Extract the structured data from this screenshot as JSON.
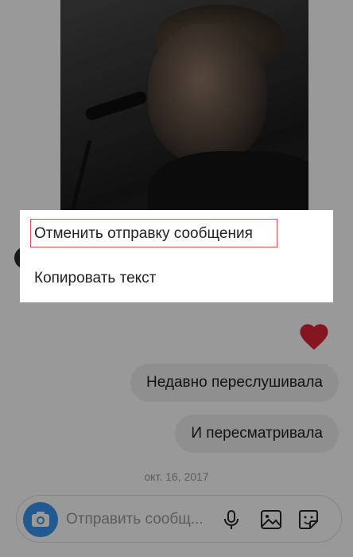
{
  "thread": {
    "messages": [
      {
        "text": "Недавно переслушивала"
      },
      {
        "text": "И пересматривала"
      }
    ],
    "date_separator": "окт. 16, 2017"
  },
  "composer": {
    "placeholder": "Отправить сообщ..."
  },
  "context_menu": {
    "unsend_label": "Отменить отправку сообщения",
    "copy_label": "Копировать текст"
  },
  "colors": {
    "accent": "#3897f0",
    "heart": "#e0243a",
    "highlight": "#e05050"
  },
  "icons": {
    "camera": "camera-icon",
    "mic": "microphone-icon",
    "gallery": "gallery-icon",
    "sticker": "sticker-icon",
    "heart": "heart-icon"
  }
}
